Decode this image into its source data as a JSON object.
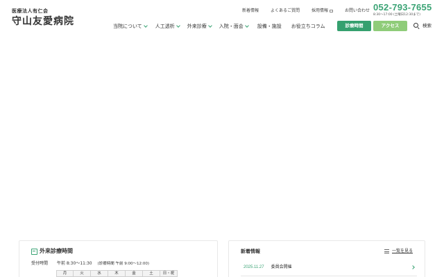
{
  "header": {
    "logo_sub": "医療法人有仁会",
    "logo_main": "守山友愛病院",
    "utility_nav": [
      "新着情報",
      "よくあるご質問",
      "採用情報",
      "お問い合わせ"
    ],
    "phone": "052-793-7655",
    "phone_hours": "8:30〜17:00 (土曜日12:30まで)",
    "main_nav": [
      "当院について",
      "人工透析",
      "外来診療",
      "入院・面会",
      "設備・施設",
      "お役立ちコラム"
    ],
    "btn_hours": "診療時間",
    "btn_access": "アクセス",
    "search_label": "検索"
  },
  "colors": {
    "accent": "#3aa374",
    "access_button": "#8fcc79"
  },
  "hours_card": {
    "title": "外来診療時間",
    "reception_label": "受付時間",
    "reception_value": "午前 8:30〜11:30",
    "reception_note": "(診療時間 午前 9:00〜12:00)",
    "days": [
      "月",
      "火",
      "水",
      "木",
      "金",
      "土",
      "日・祝"
    ]
  },
  "news_card": {
    "title": "新着情報",
    "view_all": "一覧を見る",
    "items": [
      {
        "date": "2025.11.27",
        "text": "委員会開催"
      }
    ]
  }
}
